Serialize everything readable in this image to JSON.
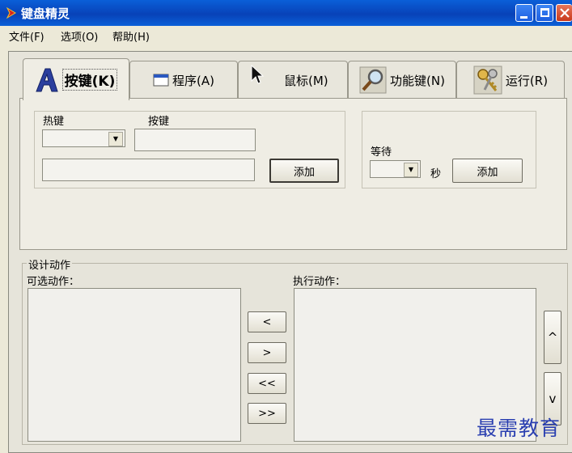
{
  "window": {
    "title": "键盘精灵"
  },
  "menu": [
    "文件(F)",
    "选项(O)",
    "帮助(H)"
  ],
  "tabs": [
    {
      "label": "按键(K)",
      "icon": "letter-a-icon",
      "selected": true
    },
    {
      "label": "程序(A)",
      "icon": "window-icon"
    },
    {
      "label": "鼠标(M)",
      "icon": "cursor-icon"
    },
    {
      "label": "功能键(N)",
      "icon": "magnifier-icon"
    },
    {
      "label": "运行(R)",
      "icon": "keys-icon"
    }
  ],
  "keys_group": {
    "hotkey_label": "热键",
    "key_label": "按键",
    "hotkey_value": "",
    "key_value": "",
    "command_value": "",
    "add_label": "添加"
  },
  "wait_group": {
    "wait_label": "等待",
    "seconds_unit": "秒",
    "wait_value": "",
    "add_label": "添加"
  },
  "design": {
    "title": "设计动作",
    "available_label": "可选动作：",
    "execute_label": "执行动作：",
    "move_buttons": [
      "<",
      ">",
      "<<",
      ">>"
    ],
    "up_label": "^",
    "down_label": "v"
  },
  "watermark": "最需教育",
  "colors": {
    "titlebar": "#0a5fd8",
    "face": "#ece9d8",
    "close": "#c8391c"
  }
}
